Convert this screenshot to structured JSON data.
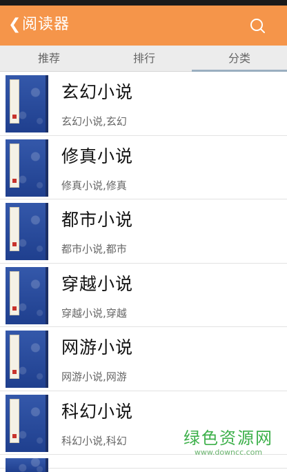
{
  "header": {
    "back_glyph": "❮",
    "title": "阅读器",
    "search_icon": "search-icon"
  },
  "tabs": [
    {
      "label": "推荐",
      "active": false
    },
    {
      "label": "排行",
      "active": false
    },
    {
      "label": "分类",
      "active": true
    }
  ],
  "categories": [
    {
      "name": "玄幻小说",
      "desc": "玄幻小说,玄幻"
    },
    {
      "name": "修真小说",
      "desc": "修真小说,修真"
    },
    {
      "name": "都市小说",
      "desc": "都市小说,都市"
    },
    {
      "name": "穿越小说",
      "desc": "穿越小说,穿越"
    },
    {
      "name": "网游小说",
      "desc": "网游小说,网游"
    },
    {
      "name": "科幻小说",
      "desc": "科幻小说,科幻"
    }
  ],
  "watermark": {
    "title": "绿色资源网",
    "url": "www.downcc.com"
  },
  "colors": {
    "appbar": "#f5954a",
    "tab_indicator": "#9aaec0",
    "cover": "#2a4fa3",
    "watermark": "#3db04a"
  }
}
